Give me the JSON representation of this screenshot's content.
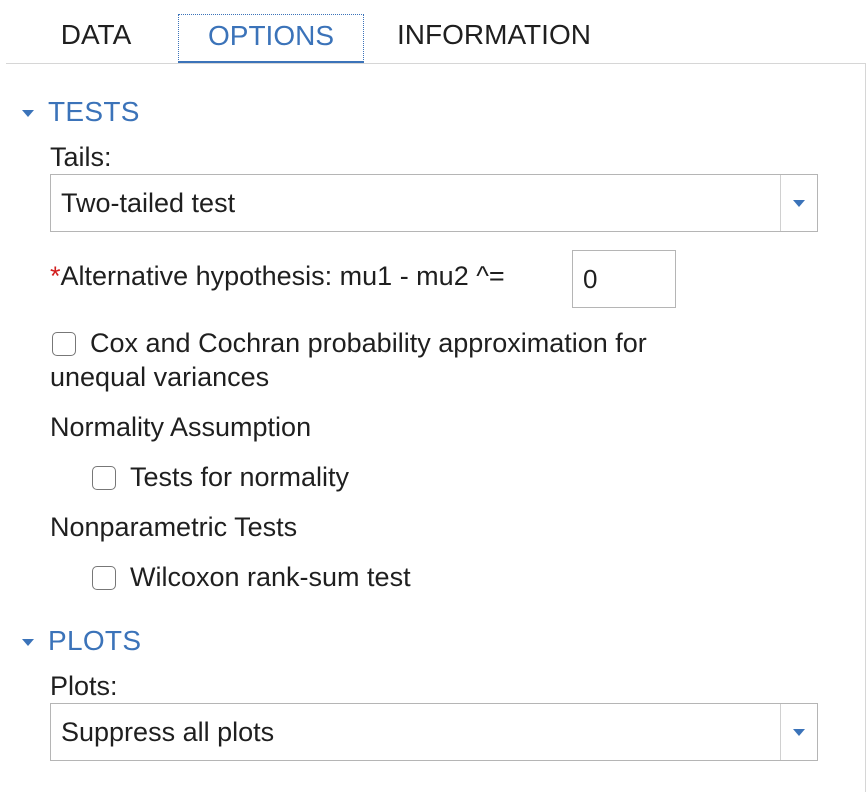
{
  "tabs": {
    "data": "DATA",
    "options": "OPTIONS",
    "information": "INFORMATION",
    "active": "OPTIONS"
  },
  "tests": {
    "title": "TESTS",
    "tails_label": "Tails:",
    "tails_value": "Two-tailed test",
    "required_mark": "*",
    "alt_hyp_label": "Alternative hypothesis: mu1 - mu2 ^=",
    "alt_hyp_value": "0",
    "cox_cochran_line1": "Cox and Cochran probability approximation for",
    "cox_cochran_line2": "unequal variances",
    "cox_cochran_checked": false,
    "normality_heading": "Normality Assumption",
    "normality_label": "Tests for normality",
    "normality_checked": false,
    "nonparametric_heading": "Nonparametric Tests",
    "wilcoxon_label": "Wilcoxon rank-sum test",
    "wilcoxon_checked": false
  },
  "plots": {
    "title": "PLOTS",
    "plots_label": "Plots:",
    "plots_value": "Suppress all plots"
  },
  "colors": {
    "accent": "#3b73b9",
    "required": "#d21f1f",
    "border": "#b5b5b5",
    "text": "#1f1f1f"
  },
  "icons": {
    "section_toggle": "triangle-down-icon",
    "dropdown": "caret-down-icon"
  }
}
